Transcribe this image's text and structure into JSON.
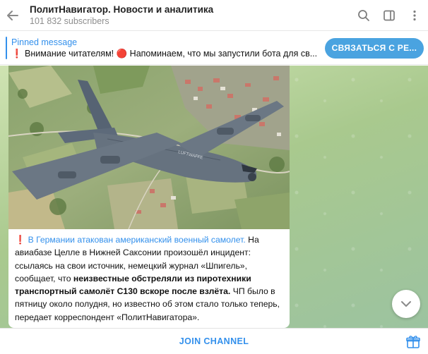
{
  "header": {
    "title": "ПолитНавигатор. Новости и аналитика",
    "subscribers": "101 832 subscribers",
    "icons": [
      "back-arrow-icon",
      "search-icon",
      "sidebar-icon",
      "more-vertical-icon"
    ]
  },
  "pinned": {
    "label": "Pinned message",
    "emoji1": "❗",
    "text1": " Внимание читателям! ",
    "emoji2": "🔴",
    "text2": " Напоминаем, что мы запустили бота для св...",
    "cta": "СВЯЗАТЬСЯ С РЕ..."
  },
  "post": {
    "emoji": "❗",
    "headline": "В Германии атакован американский военный самолет.",
    "p1": " На авиабазе Целле в Нижней Саксонии произошёл инцидент: ссылаясь на свои источник, немецкий журнал «Шпигель», сообщает, что ",
    "bold": "неизвестные обстреляли из пиротехники транспортный самолёт С130 вскоре после взлёта.",
    "p2": " ЧП было в пятницу около полудня, но известно об этом стало только теперь, передает корреспондент «ПолитНавигатора».",
    "aircraft_marking": "LUFTWAFFE"
  },
  "footer": {
    "join": "JOIN CHANNEL"
  },
  "colors": {
    "accent": "#3390ec",
    "cta": "#4aa3e0",
    "red": "#e03131"
  }
}
